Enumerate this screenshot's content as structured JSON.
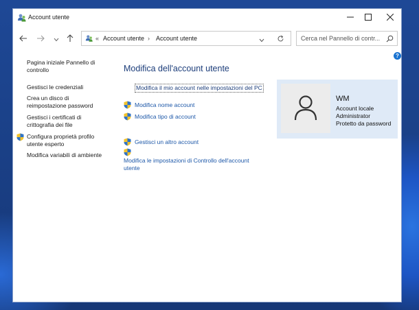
{
  "window": {
    "title": "Account utente",
    "minimize_icon": "minimize-icon",
    "maximize_icon": "maximize-icon",
    "close_icon": "close-icon"
  },
  "address_bar": {
    "chevrons": "«",
    "crumbs": [
      "Account utente",
      "Account utente"
    ],
    "separator": "›",
    "search_placeholder": "Cerca nel Pannello di contr..."
  },
  "left_nav": {
    "items": [
      {
        "label": "Pagina iniziale Pannello di controllo"
      },
      {
        "label": "Gestisci le credenziali"
      },
      {
        "label": "Crea un disco di reimpostazione password"
      },
      {
        "label": "Gestisci i certificati di crittografia dei file"
      },
      {
        "label": "Configura proprietà profilo utente esperto",
        "icon": "shield-icon"
      },
      {
        "label": "Modifica variabili di ambiente"
      }
    ]
  },
  "main": {
    "heading": "Modifica dell'account utente",
    "links": [
      {
        "label": "Modifica il mio account nelle impostazioni del PC"
      },
      {
        "label": "Modifica nome account",
        "icon": "shield-icon"
      },
      {
        "label": "Modifica tipo di account",
        "icon": "shield-icon"
      },
      {
        "label": "Gestisci un altro account",
        "icon": "shield-icon"
      },
      {
        "label": "Modifica le impostazioni di Controllo dell'account utente",
        "icon": "shield-icon"
      }
    ]
  },
  "account_card": {
    "name": "WM",
    "type": "Account locale",
    "role": "Administrator",
    "password": "Protetto da password"
  },
  "colors": {
    "link": "#1c57a8",
    "heading": "#1c3d7a",
    "card_bg": "#dfeaf7"
  }
}
